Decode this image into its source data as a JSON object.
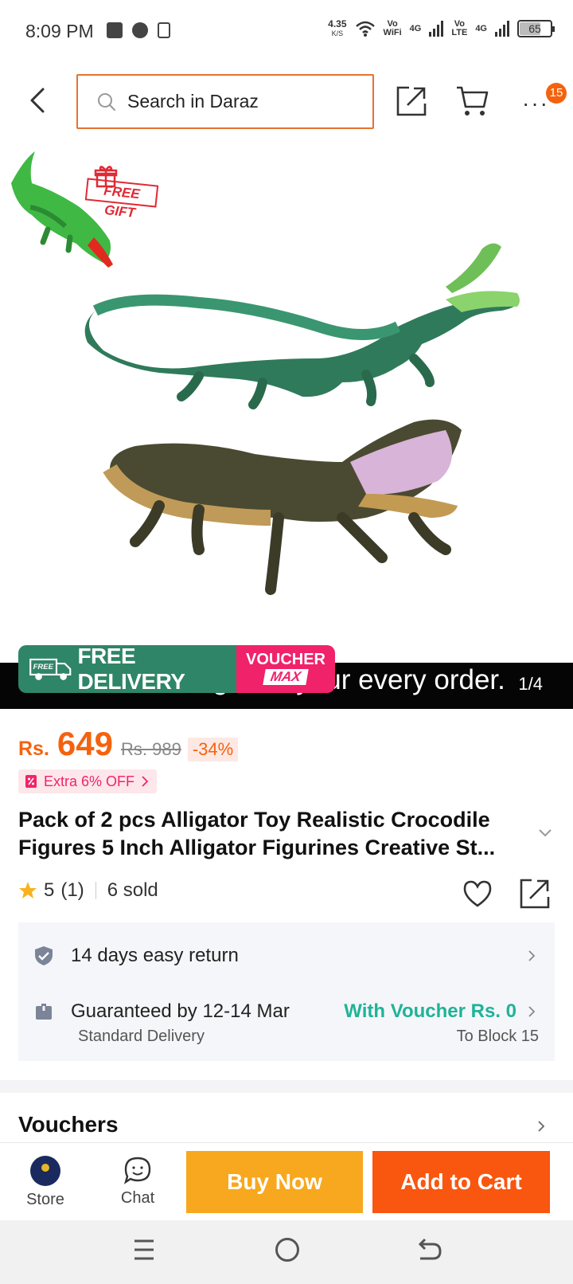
{
  "status_bar": {
    "time": "8:09 PM",
    "net_speed": "4.35",
    "net_unit": "K/S",
    "vo_wifi_top": "Vo",
    "vo_wifi_bottom": "WiFi",
    "lte_top": "Vo",
    "lte_bottom": "LTE",
    "network_1": "4G",
    "network_2": "4G",
    "battery": "65"
  },
  "header": {
    "search_placeholder": "Search in Daraz",
    "more_badge_count": "15"
  },
  "gallery": {
    "badge_text": "FREE GIFT",
    "caption": "l mini crocodile gift on your every order.",
    "counter": "1/4",
    "free_delivery_badge": "FREE",
    "free_delivery_label": "FREE DELIVERY",
    "voucher_top": "VOUCHER",
    "voucher_bottom": "MAX",
    "current_image": 1,
    "total_images": 4
  },
  "price": {
    "currency": "Rs.",
    "amount": "649",
    "original": "Rs. 989",
    "discount": "-34%",
    "extra_offer": "Extra 6% OFF"
  },
  "product": {
    "title": "Pack of 2 pcs Alligator Toy Realistic Crocodile Figures 5 Inch Alligator Figurines Creative St...",
    "rating": "5",
    "rating_count": "(1)",
    "sold": "6 sold"
  },
  "service": {
    "return_text": "14 days easy return",
    "guarantee_text": "Guaranteed by 12-14 Mar",
    "voucher_text": "With Voucher Rs. 0",
    "delivery_type": "Standard Delivery",
    "destination": "To Block 15"
  },
  "vouchers": {
    "title": "Vouchers"
  },
  "bottom_bar": {
    "store_label": "Store",
    "chat_label": "Chat",
    "buy_now_label": "Buy Now",
    "add_to_cart_label": "Add to Cart"
  },
  "colors": {
    "brand_orange": "#f5620f",
    "buy_now": "#f8a81e",
    "add_to_cart": "#f9560f",
    "free_delivery_green": "#2f8567",
    "voucher_pink": "#f0226a",
    "voucher_teal": "#1fb398"
  },
  "icons": [
    "back-icon",
    "search-icon",
    "share-icon",
    "cart-icon",
    "more-icon",
    "gift-icon",
    "truck-icon",
    "tag-icon",
    "star-icon",
    "heart-icon",
    "shield-icon",
    "box-icon",
    "chevron-right-icon",
    "chevron-down-icon",
    "chat-icon",
    "menu-icon",
    "home-icon",
    "nav-back-icon"
  ]
}
